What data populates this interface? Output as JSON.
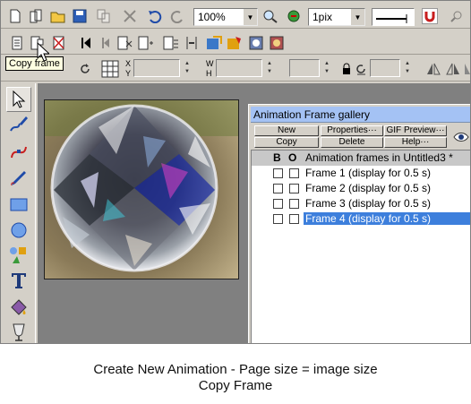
{
  "toolbar": {
    "zoom_value": "100%",
    "line_width_value": "1pix",
    "coord_labels": {
      "x": "X",
      "y": "Y",
      "w": "W",
      "h": "H"
    }
  },
  "tooltip": {
    "text": "Copy frame"
  },
  "gallery": {
    "title": "Animation Frame gallery",
    "buttons": {
      "new": "New",
      "properties": "Properties···",
      "gif_preview": "GIF Preview···",
      "copy": "Copy",
      "delete": "Delete",
      "help": "Help···"
    },
    "header": {
      "col_b": "B",
      "col_o": "O",
      "label": "Animation frames in Untitled3 *"
    },
    "frames": [
      {
        "label": "Frame 1 (display for 0.5 s)",
        "selected": false
      },
      {
        "label": "Frame 2 (display for 0.5 s)",
        "selected": false
      },
      {
        "label": "Frame 3 (display for 0.5 s)",
        "selected": false
      },
      {
        "label": "Frame 4 (display for 0.5 s)",
        "selected": true
      }
    ]
  },
  "caption": {
    "line1": "Create New Animation - Page size = image size",
    "line2": "Copy Frame"
  },
  "colors": {
    "selection": "#3d7fdc",
    "panel_title": "#a4c2f4",
    "chrome": "#d4d0c8",
    "canvas": "#808080"
  }
}
